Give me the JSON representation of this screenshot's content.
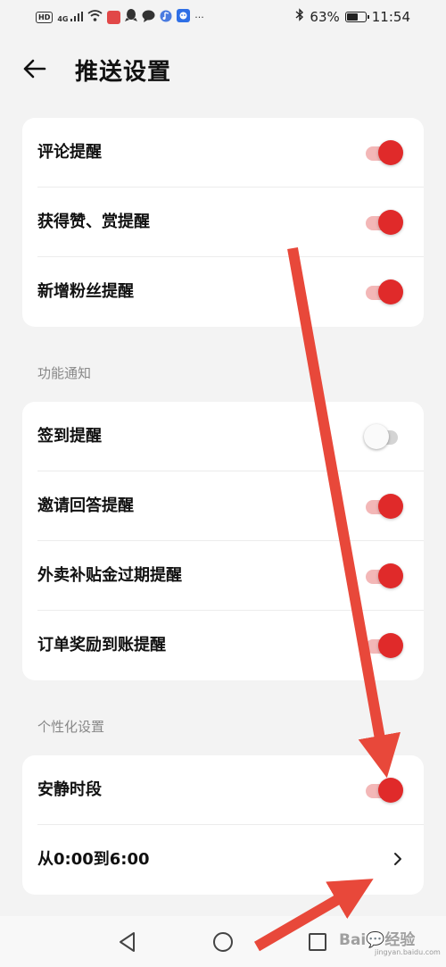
{
  "status_bar": {
    "left_icons": [
      "hd-icon",
      "4g-signal-icon",
      "wifi-icon",
      "red-app-icon",
      "qq-icon",
      "chat-icon",
      "music-icon",
      "blue-app-icon",
      "more-icon"
    ],
    "hd": "HD",
    "network": "4G",
    "more": "···",
    "battery_percent": "63%",
    "battery_level": 0.63,
    "time": "11:54"
  },
  "header": {
    "title": "推送设置"
  },
  "groups": [
    {
      "section_label": "",
      "items": [
        {
          "label": "评论提醒",
          "toggle": true
        },
        {
          "label": "获得赞、赏提醒",
          "toggle": true
        },
        {
          "label": "新增粉丝提醒",
          "toggle": true
        }
      ]
    },
    {
      "section_label": "功能通知",
      "items": [
        {
          "label": "签到提醒",
          "toggle": false
        },
        {
          "label": "邀请回答提醒",
          "toggle": true
        },
        {
          "label": "外卖补贴金过期提醒",
          "toggle": true
        },
        {
          "label": "订单奖励到账提醒",
          "toggle": true
        }
      ]
    },
    {
      "section_label": "个性化设置",
      "items": [
        {
          "label": "安静时段",
          "toggle": true
        },
        {
          "label": "从0:00到6:00",
          "chevron": true
        }
      ]
    }
  ],
  "watermark": {
    "text": "Bai💬经验",
    "sub": "jingyan.baidu.com"
  },
  "colors": {
    "accent": "#e02a2a",
    "track_on": "#f3b7b7",
    "background": "#f3f3f3",
    "card": "#ffffff",
    "annotation_arrow": "#e8483a"
  }
}
